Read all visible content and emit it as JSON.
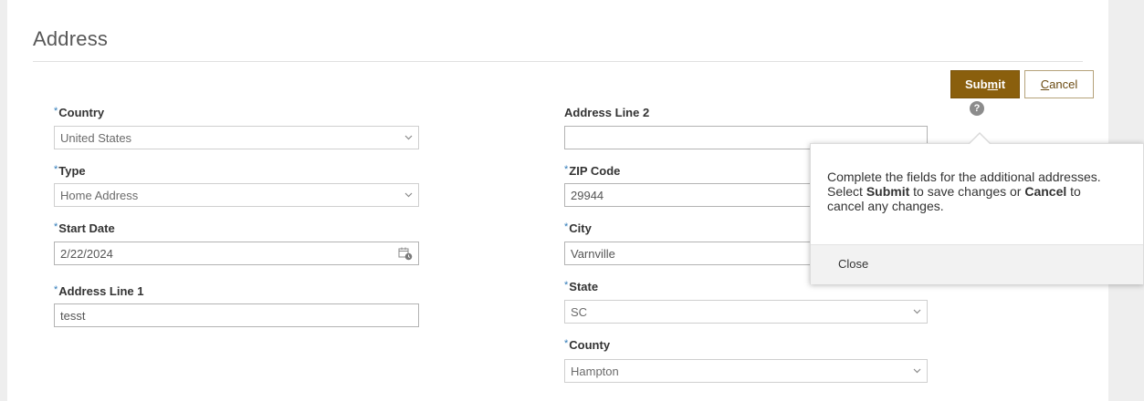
{
  "section_title": "Address",
  "toolbar": {
    "submit_label_pre": "Sub",
    "submit_label_mnemonic": "m",
    "submit_label_post": "it",
    "cancel_label_mnemonic": "C",
    "cancel_label_post": "ancel",
    "help_glyph": "?"
  },
  "required_marker": "*",
  "form": {
    "country": {
      "label": "Country",
      "value": "United States",
      "required": true
    },
    "type": {
      "label": "Type",
      "value": "Home Address",
      "required": true
    },
    "start_date": {
      "label": "Start Date",
      "value": "2/22/2024",
      "required": true
    },
    "address_line_1": {
      "label": "Address Line 1",
      "value": "tesst",
      "required": true
    },
    "address_line_2": {
      "label": "Address Line 2",
      "value": "",
      "required": false
    },
    "zip_code": {
      "label": "ZIP Code",
      "value": "29944",
      "required": true
    },
    "city": {
      "label": "City",
      "value": "Varnville",
      "required": true
    },
    "state": {
      "label": "State",
      "value": "SC",
      "required": true
    },
    "county": {
      "label": "County",
      "value": "Hampton",
      "required": true
    }
  },
  "help_popup": {
    "line_1": "Complete the fields for the additional addresses.",
    "line_2_pre": "Select ",
    "line_2_submit": "Submit",
    "line_2_mid": " to save changes or ",
    "line_2_cancel": "Cancel",
    "line_2_post": " to",
    "line_3": "cancel any changes.",
    "close_label": "Close"
  },
  "icons": {
    "dropdown": "chevron-down-icon",
    "date": "calendar-icon",
    "help": "help-icon"
  },
  "colors": {
    "primary_button": "#8a5f0d",
    "required_marker": "#2e7ab8",
    "help_icon": "#8c8c8c"
  }
}
